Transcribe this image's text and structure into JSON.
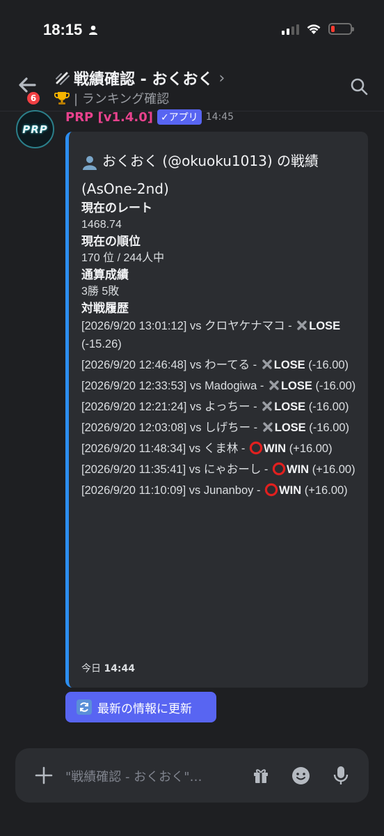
{
  "status_bar": {
    "time": "18:15",
    "battery_level": 0.18
  },
  "header": {
    "unread_badge": "6",
    "title": "戦績確認 - おくおく",
    "subtitle": "| ランキング確認",
    "title_icon": "slash-command-icon",
    "subtitle_icon": "trophy-icon"
  },
  "message": {
    "author": "PRP [v1.4.0]",
    "app_tag": "✓アプリ",
    "timestamp": "14:45",
    "avatar_text": "PRP",
    "embed": {
      "accent_color": "#2c8ef0",
      "title": "おくおく (@okuoku1013) の戦績 (AsOne-2nd)",
      "fields": {
        "rate_label": "現在のレート",
        "rate_value": "1468.74",
        "rank_label": "現在の順位",
        "rank_value": "170 位 / 244人中",
        "record_label": "通算成績",
        "record_value": "3勝 5敗",
        "history_label": "対戦履歴"
      },
      "history": [
        {
          "time": "[2026/9/20 13:01:12]",
          "opponent": "クロヤケナマコ",
          "result": "LOSE",
          "delta": "(-15.26)"
        },
        {
          "time": "[2026/9/20 12:46:48]",
          "opponent": "わーてる",
          "result": "LOSE",
          "delta": "(-16.00)"
        },
        {
          "time": "[2026/9/20 12:33:53]",
          "opponent": "Madogiwa",
          "result": "LOSE",
          "delta": "(-16.00)"
        },
        {
          "time": "[2026/9/20 12:21:24]",
          "opponent": "よっちー",
          "result": "LOSE",
          "delta": "(-16.00)"
        },
        {
          "time": "[2026/9/20 12:03:08]",
          "opponent": "しげちー",
          "result": "LOSE",
          "delta": "(-16.00)"
        },
        {
          "time": "[2026/9/20 11:48:34]",
          "opponent": "くま林",
          "result": "WIN",
          "delta": "(+16.00)"
        },
        {
          "time": "[2026/9/20 11:35:41]",
          "opponent": "にゃおーし",
          "result": "WIN",
          "delta": "(+16.00)"
        },
        {
          "time": "[2026/9/20 11:10:09]",
          "opponent": "Junanboy",
          "result": "WIN",
          "delta": "(+16.00)"
        }
      ],
      "footer_day": "今日",
      "footer_time": "14:44"
    },
    "button_label": "最新の情報に更新"
  },
  "composer": {
    "placeholder": "\"戦績確認 - おくおく\"…"
  },
  "colors": {
    "background": "#1e1f22",
    "embed_bg": "#2b2d31",
    "author": "#e8428d",
    "blurple": "#5865f2",
    "badge_red": "#f23f43"
  }
}
